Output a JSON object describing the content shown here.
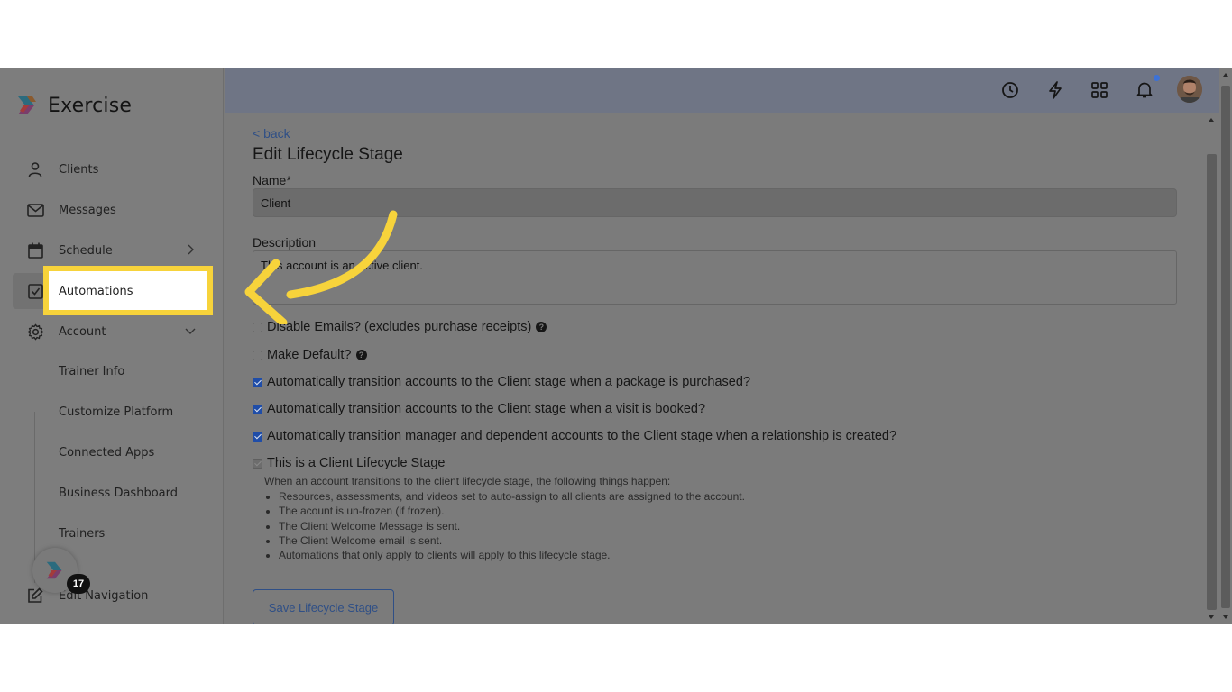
{
  "brand": {
    "name": "Exercise"
  },
  "sidebar": {
    "items": [
      {
        "label": "Clients",
        "icon": "user-icon"
      },
      {
        "label": "Messages",
        "icon": "mail-icon"
      },
      {
        "label": "Schedule",
        "icon": "calendar-icon"
      },
      {
        "label": "Automations",
        "icon": "checkbox-icon"
      },
      {
        "label": "Account",
        "icon": "gear-icon"
      }
    ],
    "sub_items": [
      "Trainer Info",
      "Customize Platform",
      "Connected Apps",
      "Business Dashboard",
      "Trainers"
    ],
    "edit_nav_label": "Edit Navigation",
    "fab_badge": "17"
  },
  "topbar": {
    "icons": [
      "history-icon",
      "lightning-icon",
      "apps-grid-icon",
      "bell-icon"
    ],
    "notification_dot_color": "#3d72d6"
  },
  "form": {
    "back_label": "< back",
    "title": "Edit Lifecycle Stage",
    "name_label": "Name*",
    "name_value": "Client",
    "description_label": "Description",
    "description_value": "This account is an active client.",
    "checkboxes": [
      {
        "label": "Disable Emails? (excludes purchase receipts)",
        "checked": false,
        "help": true
      },
      {
        "label": "Make Default?",
        "checked": false,
        "help": true
      },
      {
        "label": "Automatically transition accounts to the Client stage when a package is purchased?",
        "checked": true
      },
      {
        "label": "Automatically transition accounts to the Client stage when a visit is booked?",
        "checked": true
      },
      {
        "label": "Automatically transition manager and dependent accounts to the Client stage when a relationship is created?",
        "checked": true
      },
      {
        "label": "This is a Client Lifecycle Stage",
        "checked": true,
        "disabled": true
      }
    ],
    "info_intro": "When an account transitions to the client lifecycle stage, the following things happen:",
    "info_items": [
      "Resources, assessments, and videos set to auto-assign to all clients are assigned to the account.",
      "The acount is un-frozen (if frozen).",
      "The Client Welcome Message is sent.",
      "The Client Welcome email is sent.",
      "Automations that only apply to clients will apply to this lifecycle stage."
    ],
    "save_label": "Save Lifecycle Stage"
  },
  "colors": {
    "highlight": "#f7d33b",
    "arrow": "#f7d33b",
    "link": "#2f4f86",
    "checkbox_checked": "#1f4da8"
  }
}
